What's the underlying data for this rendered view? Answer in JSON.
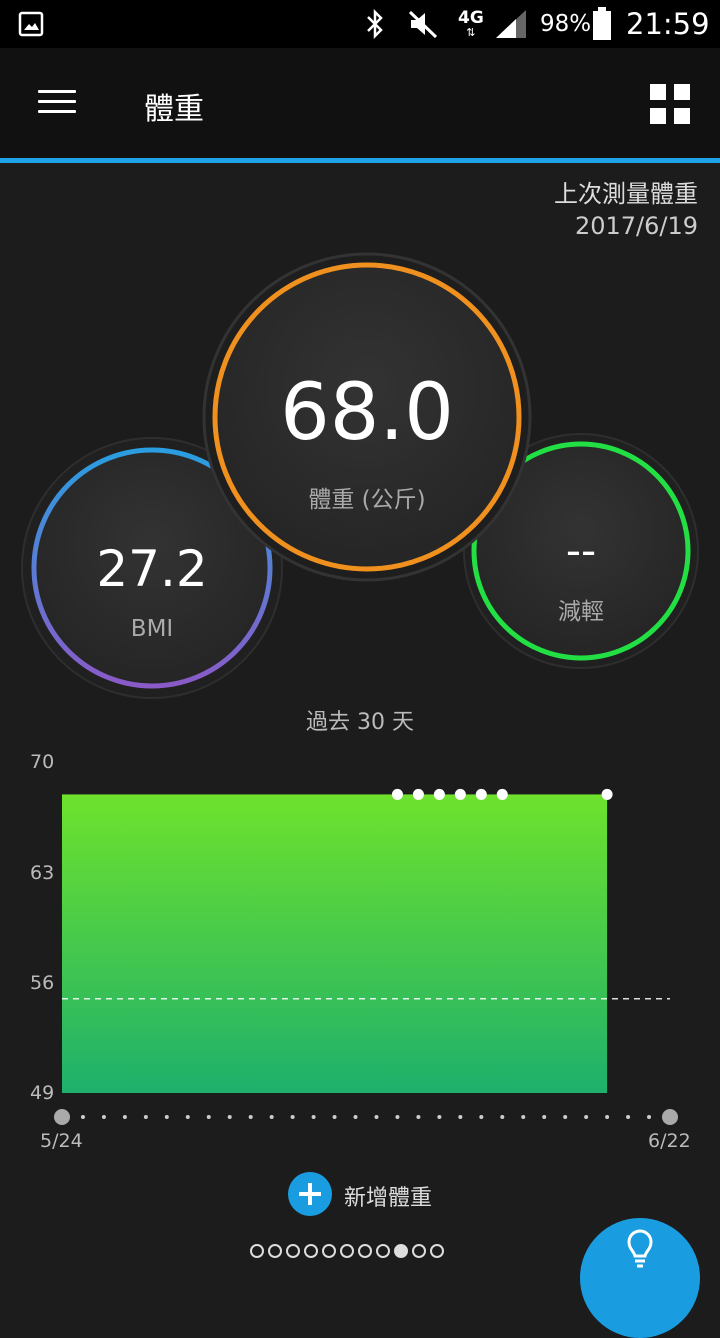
{
  "status_bar": {
    "network": "4G",
    "battery": "98%",
    "time": "21:59",
    "icons": [
      "image-icon",
      "bluetooth-icon",
      "mute-icon",
      "signal-icon",
      "battery-icon"
    ]
  },
  "app_bar": {
    "title": "體重",
    "accent_color": "#1fa3e8"
  },
  "last_measure": {
    "label": "上次測量體重",
    "date": "2017/6/19"
  },
  "stats": {
    "weight": {
      "value": "68.0",
      "label": "體重 (公斤)",
      "color": "#f0901e"
    },
    "bmi": {
      "value": "27.2",
      "label": "BMI",
      "color_start": "#2a9ee0",
      "color_end": "#8a5ac8"
    },
    "loss": {
      "value": "--",
      "label": "減輕",
      "color": "#22e044"
    }
  },
  "chart_section": {
    "period_label": "過去 30 天"
  },
  "chart_data": {
    "type": "area",
    "y_ticks": [
      "70",
      "63",
      "56",
      "49"
    ],
    "ylim": [
      49,
      70
    ],
    "x_start_label": "5/24",
    "x_end_label": "6/22",
    "area": {
      "start_day": 0,
      "end_day": 26,
      "value": 68.0
    },
    "points": [
      {
        "day": 16,
        "value": 68.0
      },
      {
        "day": 17,
        "value": 68.0
      },
      {
        "day": 18,
        "value": 68.0
      },
      {
        "day": 19,
        "value": 68.0
      },
      {
        "day": 20,
        "value": 68.0
      },
      {
        "day": 21,
        "value": 68.0
      },
      {
        "day": 26,
        "value": 68.0
      }
    ],
    "goal_line": 55,
    "days_total": 29,
    "area_color_top": "#6ee22c",
    "area_color_bottom": "#1eb06c"
  },
  "actions": {
    "add_weight_label": "新增體重"
  },
  "pager": {
    "count": 11,
    "active_index": 8
  },
  "fab": {
    "icon": "lightbulb-icon"
  }
}
